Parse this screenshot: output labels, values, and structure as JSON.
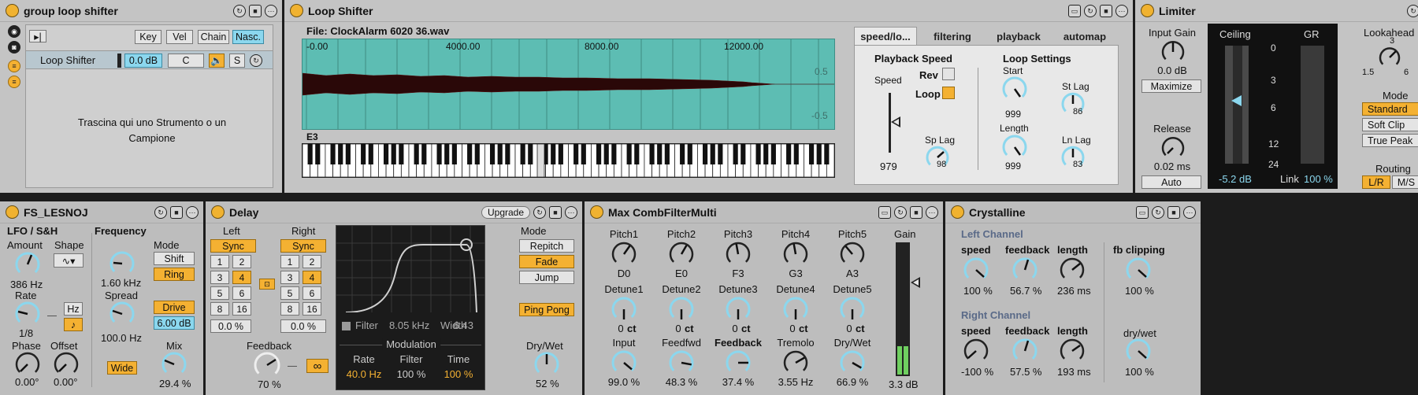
{
  "group_loop_shifter": {
    "title": "group loop shifter",
    "tabs": [
      "Key",
      "Vel",
      "Chain",
      "Nasc."
    ],
    "chain": {
      "name": "Loop Shifter",
      "volume": "0.0 dB",
      "pan": "C",
      "solo": "S"
    },
    "drop_hint": "Trascina qui uno Strumento o un Campione"
  },
  "loop_shifter": {
    "title": "Loop Shifter",
    "file": "File: ClockAlarm 6020 36.wav",
    "ruler": [
      "-0.00",
      "4000.00",
      "8000.00",
      "12000.00"
    ],
    "amp_labels": [
      "0.5",
      "-0.5"
    ],
    "note": "E3",
    "tabs": [
      "speed/lo...",
      "filtering",
      "playback",
      "automap"
    ],
    "playback_speed": {
      "heading": "Playback Speed",
      "speed_label": "Speed",
      "speed_value": "979",
      "rev_label": "Rev",
      "loop_label": "Loop",
      "sp_lag_label": "Sp Lag",
      "sp_lag_value": "98"
    },
    "loop_settings": {
      "heading": "Loop Settings",
      "start_label": "Start",
      "start_value": "999",
      "length_label": "Length",
      "length_value": "999",
      "st_lag_label": "St Lag",
      "st_lag_value": "86",
      "ln_lag_label": "Ln Lag",
      "ln_lag_value": "83"
    }
  },
  "limiter": {
    "title": "Limiter",
    "input_gain_label": "Input Gain",
    "input_gain_value": "0.0 dB",
    "maximize": "Maximize",
    "release_label": "Release",
    "release_value": "0.02 ms",
    "auto": "Auto",
    "ceiling_label": "Ceiling",
    "gr_label": "GR",
    "scale": [
      "0",
      "3",
      "6",
      "12",
      "24"
    ],
    "ceiling_value": "-5.2 dB",
    "link_label": "Link",
    "link_value": "100 %",
    "lookahead_label": "Lookahead",
    "lookahead_ticks": [
      "3",
      "1.5",
      "6"
    ],
    "mode_label": "Mode",
    "modes": [
      "Standard",
      "Soft Clip",
      "True Peak"
    ],
    "routing_label": "Routing",
    "routing": [
      "L/R",
      "M/S"
    ]
  },
  "fs_lesnoj": {
    "title": "FS_LESNOJ",
    "lfo_heading": "LFO / S&H",
    "amount_label": "Amount",
    "amount_value": "386 Hz",
    "shape_label": "Shape",
    "shape_value": "∿▾",
    "rate_label": "Rate",
    "rate_value": "1/8",
    "hz": "Hz",
    "note_symbol": "♪",
    "phase_label": "Phase",
    "phase_value": "0.00°",
    "offset_label": "Offset",
    "offset_value": "0.00°",
    "frequency_heading": "Frequency",
    "frequency_value": "1.60 kHz",
    "spread_label": "Spread",
    "spread_value": "100.0 Hz",
    "wide": "Wide",
    "mode_label": "Mode",
    "modes": [
      "Shift",
      "Ring"
    ],
    "drive": "Drive",
    "drive_value": "6.00 dB",
    "mix_label": "Mix",
    "mix_value": "29.4 %"
  },
  "delay": {
    "title": "Delay",
    "upgrade": "Upgrade",
    "left_label": "Left",
    "right_label": "Right",
    "sync": "Sync",
    "grid": [
      "1",
      "2",
      "3",
      "4",
      "5",
      "6",
      "8",
      "16"
    ],
    "left_offset": "0.0 %",
    "right_offset": "0.0 %",
    "feedback_label": "Feedback",
    "feedback_value": "70 %",
    "infinity": "∞",
    "filter_label": "Filter",
    "filter_value": "8.05 kHz",
    "width_label": "Width",
    "width_value": "6.43",
    "modulation_label": "Modulation",
    "mod_rate_label": "Rate",
    "mod_rate_value": "40.0 Hz",
    "mod_filter_label": "Filter",
    "mod_filter_value": "100 %",
    "mod_time_label": "Time",
    "mod_time_value": "100 %",
    "mode_label": "Mode",
    "modes": [
      "Repitch",
      "Fade",
      "Jump"
    ],
    "ping_pong": "Ping Pong",
    "drywet_label": "Dry/Wet",
    "drywet_value": "52 %"
  },
  "comb": {
    "title": "Max CombFilterMulti",
    "pitch": [
      {
        "label": "Pitch1",
        "value": "D0"
      },
      {
        "label": "Pitch2",
        "value": "E0"
      },
      {
        "label": "Pitch3",
        "value": "F3"
      },
      {
        "label": "Pitch4",
        "value": "G3"
      },
      {
        "label": "Pitch5",
        "value": "A3"
      }
    ],
    "detune": [
      {
        "label": "Detune1",
        "value": "0",
        "unit": "ct"
      },
      {
        "label": "Detune2",
        "value": "0",
        "unit": "ct"
      },
      {
        "label": "Detune3",
        "value": "0",
        "unit": "ct"
      },
      {
        "label": "Detune4",
        "value": "0",
        "unit": "ct"
      },
      {
        "label": "Detune5",
        "value": "0",
        "unit": "ct"
      }
    ],
    "bottom": [
      {
        "label": "Input",
        "value": "99.0 %"
      },
      {
        "label": "Feedfwd",
        "value": "48.3 %"
      },
      {
        "label": "Feedback",
        "value": "37.4 %"
      },
      {
        "label": "Tremolo",
        "value": "3.55 Hz"
      },
      {
        "label": "Dry/Wet",
        "value": "66.9 %"
      }
    ],
    "gain_label": "Gain",
    "gain_value": "3.3 dB"
  },
  "crystalline": {
    "title": "Crystalline",
    "left_heading": "Left Channel",
    "right_heading": "Right Channel",
    "speed_label": "speed",
    "feedback_label": "feedback",
    "length_label": "length",
    "left_speed": "100 %",
    "left_feedback": "56.7 %",
    "left_length": "236 ms",
    "right_speed": "-100 %",
    "right_feedback": "57.5 %",
    "right_length": "193 ms",
    "fb_clipping_label": "fb clipping",
    "fb_clipping_value": "100 %",
    "drywet_label": "dry/wet",
    "drywet_value": "100 %"
  },
  "colors": {
    "accent": "#f4b132",
    "cyan": "#8bd7ee",
    "waveform_bg": "#5dbdb3",
    "panel": "#c4c4c4",
    "dark": "#1c1c1c"
  }
}
